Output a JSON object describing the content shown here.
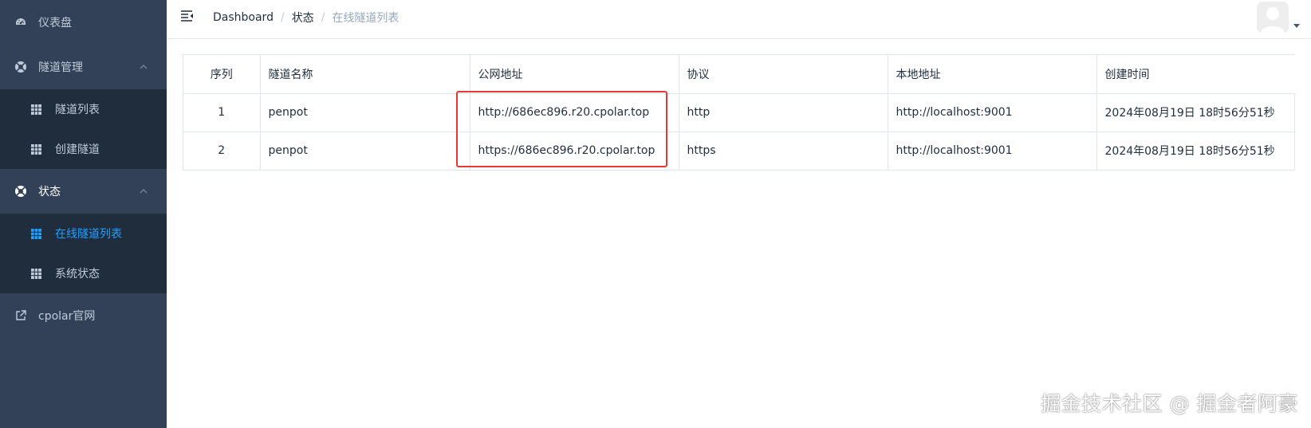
{
  "sidebar": {
    "items": [
      {
        "label": "仪表盘",
        "icon": "dashboard-icon"
      },
      {
        "label": "隧道管理",
        "icon": "lifebuoy-icon",
        "expanded": true,
        "children": [
          {
            "label": "隧道列表",
            "icon": "table-icon"
          },
          {
            "label": "创建隧道",
            "icon": "table-icon"
          }
        ]
      },
      {
        "label": "状态",
        "icon": "lifebuoy-icon",
        "expanded": true,
        "children": [
          {
            "label": "在线隧道列表",
            "icon": "table-icon",
            "active": true
          },
          {
            "label": "系统状态",
            "icon": "table-icon"
          }
        ]
      },
      {
        "label": "cpolar官网",
        "icon": "external-link-icon"
      }
    ]
  },
  "header": {
    "breadcrumb": [
      "Dashboard",
      "状态",
      "在线隧道列表"
    ]
  },
  "table": {
    "columns": [
      "序列",
      "隧道名称",
      "公网地址",
      "协议",
      "本地地址",
      "创建时间"
    ],
    "rows": [
      [
        "1",
        "penpot",
        "http://686ec896.r20.cpolar.top",
        "http",
        "http://localhost:9001",
        "2024年08月19日 18时56分51秒"
      ],
      [
        "2",
        "penpot",
        "https://686ec896.r20.cpolar.top",
        "https",
        "http://localhost:9001",
        "2024年08月19日 18时56分51秒"
      ]
    ]
  },
  "watermark": "掘金技术社区 @ 掘金者阿豪",
  "colors": {
    "sidebar_bg": "#324157",
    "submenu_bg": "#1f2d3d",
    "active": "#20a0ff",
    "highlight": "#e53935"
  }
}
